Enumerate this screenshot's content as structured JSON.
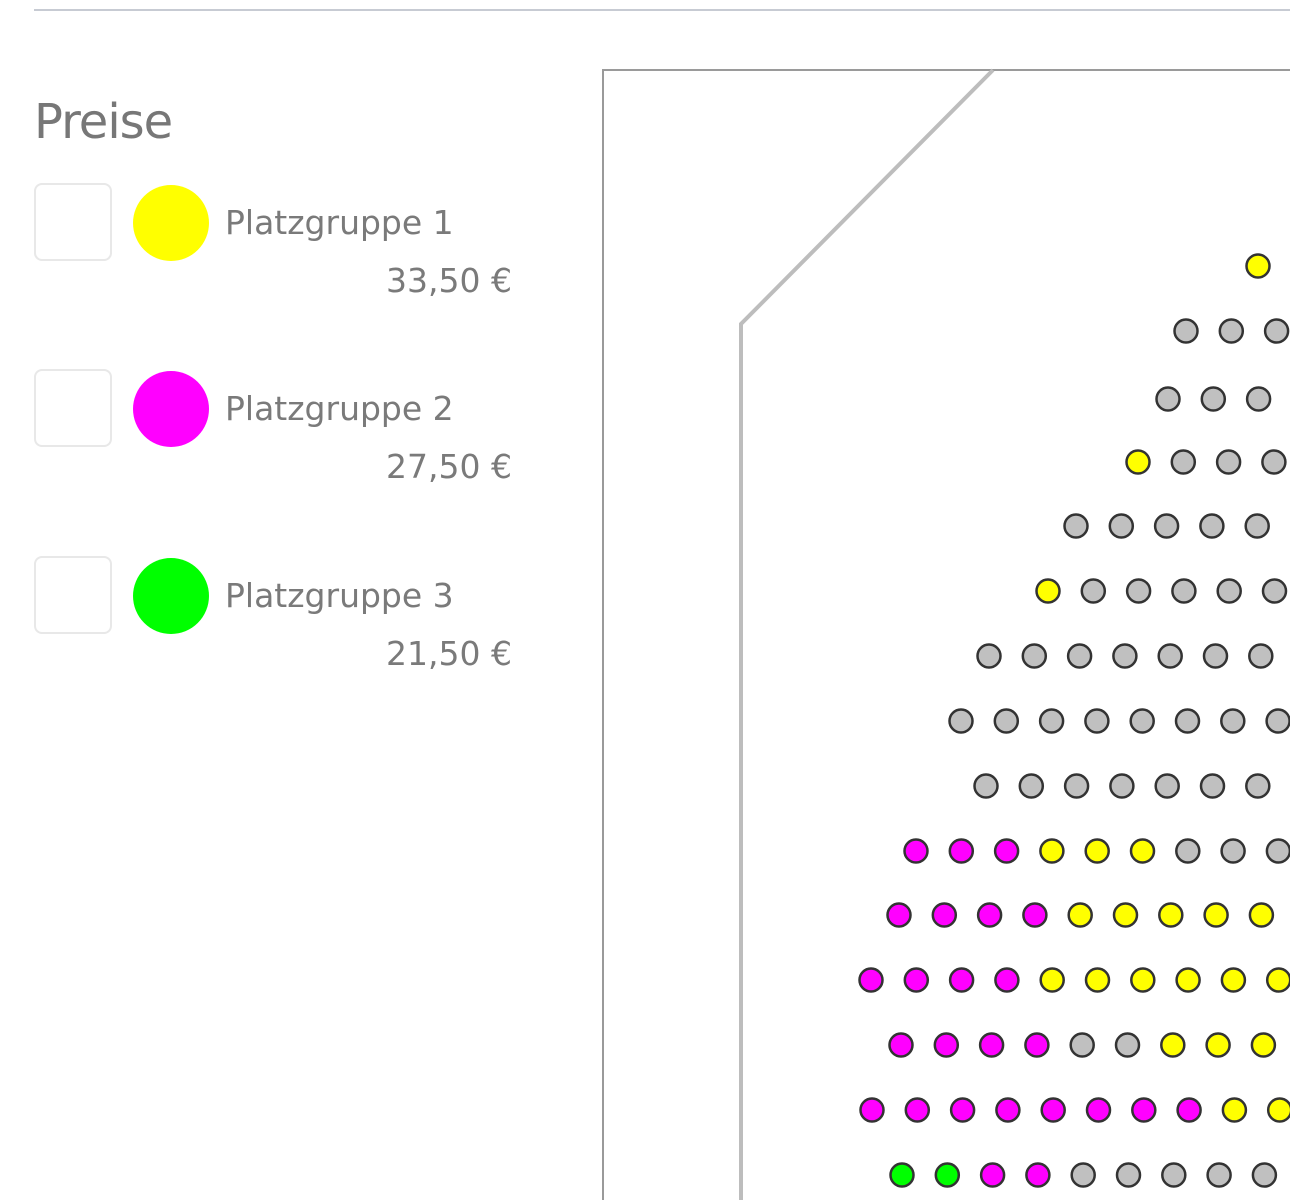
{
  "legend": {
    "title": "Preise",
    "groups": [
      {
        "name": "Platzgruppe 1",
        "price": "33,50 €",
        "color": "#ffff00"
      },
      {
        "name": "Platzgruppe 2",
        "price": "27,50 €",
        "color": "#ff00ff"
      },
      {
        "name": "Platzgruppe 3",
        "price": "21,50 €",
        "color": "#00ff00"
      }
    ]
  },
  "seat_colors": {
    "1": "#ffff00",
    "2": "#ff00ff",
    "3": "#00ff00",
    "unavailable": "#c0c0c0"
  },
  "seat_rows": [
    [
      "1"
    ],
    [
      "u",
      "u",
      "u"
    ],
    [
      "u",
      "u",
      "u"
    ],
    [
      "1",
      "u",
      "u",
      "u"
    ],
    [
      "u",
      "u",
      "u",
      "u",
      "u"
    ],
    [
      "1",
      "u",
      "u",
      "u",
      "u",
      "u"
    ],
    [
      "u",
      "u",
      "u",
      "u",
      "u",
      "u",
      "u"
    ],
    [
      "u",
      "u",
      "u",
      "u",
      "u",
      "u",
      "u",
      "u"
    ],
    [
      "u",
      "u",
      "u",
      "u",
      "u",
      "u",
      "u"
    ],
    [
      "2",
      "2",
      "2",
      "1",
      "1",
      "1",
      "u",
      "u",
      "u"
    ],
    [
      "2",
      "2",
      "2",
      "2",
      "1",
      "1",
      "1",
      "1",
      "1"
    ],
    [
      "2",
      "2",
      "2",
      "2",
      "1",
      "1",
      "1",
      "1",
      "1",
      "1"
    ],
    [
      "2",
      "2",
      "2",
      "2",
      "u",
      "u",
      "1",
      "1",
      "1"
    ],
    [
      "2",
      "2",
      "2",
      "2",
      "2",
      "2",
      "2",
      "2",
      "1",
      "1"
    ],
    [
      "3",
      "3",
      "2",
      "2",
      "u",
      "u",
      "u",
      "u",
      "u"
    ]
  ]
}
